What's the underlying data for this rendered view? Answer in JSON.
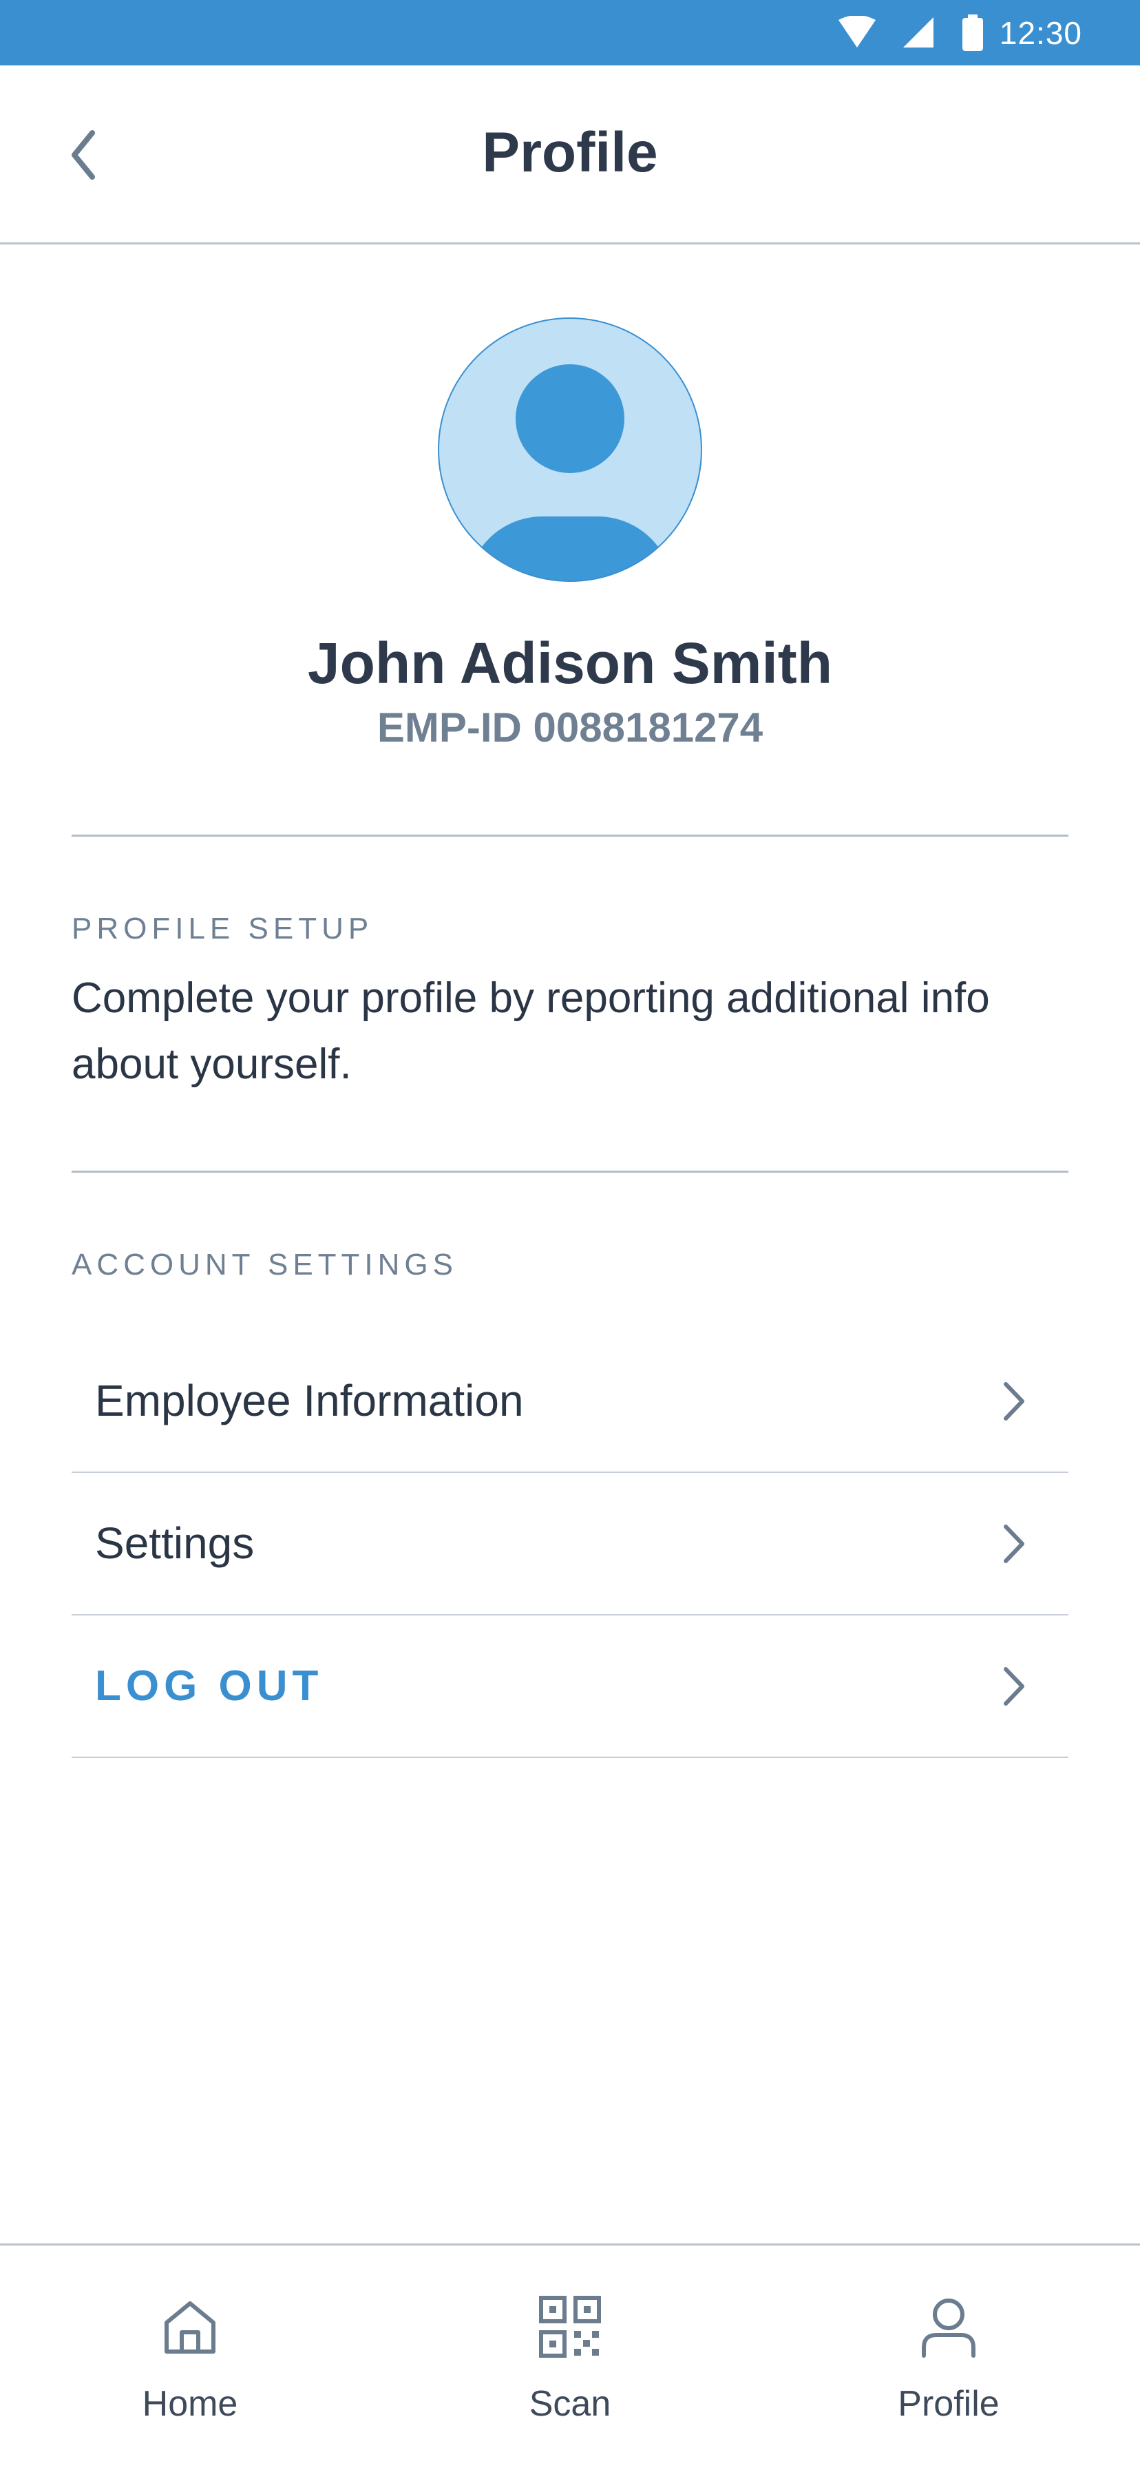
{
  "status_bar": {
    "time": "12:30",
    "icons": [
      "wifi-icon",
      "cellular-signal-icon",
      "battery-icon"
    ],
    "background": "#3a8fd0"
  },
  "header": {
    "title": "Profile",
    "back_icon": "chevron-left-icon"
  },
  "profile": {
    "avatar_icon": "user-avatar-icon",
    "name": "John Adison Smith",
    "employee_id": "EMP-ID 0088181274"
  },
  "profile_setup": {
    "heading": "PROFILE SETUP",
    "description": "Complete your profile by reporting additional info about yourself."
  },
  "account_settings": {
    "heading": "ACCOUNT SETTINGS",
    "items": [
      {
        "label": "Employee Information",
        "icon": "chevron-right-icon"
      },
      {
        "label": "Settings",
        "icon": "chevron-right-icon"
      },
      {
        "label": "LOG OUT",
        "icon": "chevron-right-icon"
      }
    ]
  },
  "bottom_nav": {
    "items": [
      {
        "label": "Home",
        "icon": "home-icon"
      },
      {
        "label": "Scan",
        "icon": "qr-code-icon"
      },
      {
        "label": "Profile",
        "icon": "user-icon"
      }
    ]
  },
  "colors": {
    "accent": "#3a8fd0",
    "avatar_fill": "#bfe0f5",
    "text_primary": "#2a3545",
    "text_secondary": "#6f8093"
  }
}
